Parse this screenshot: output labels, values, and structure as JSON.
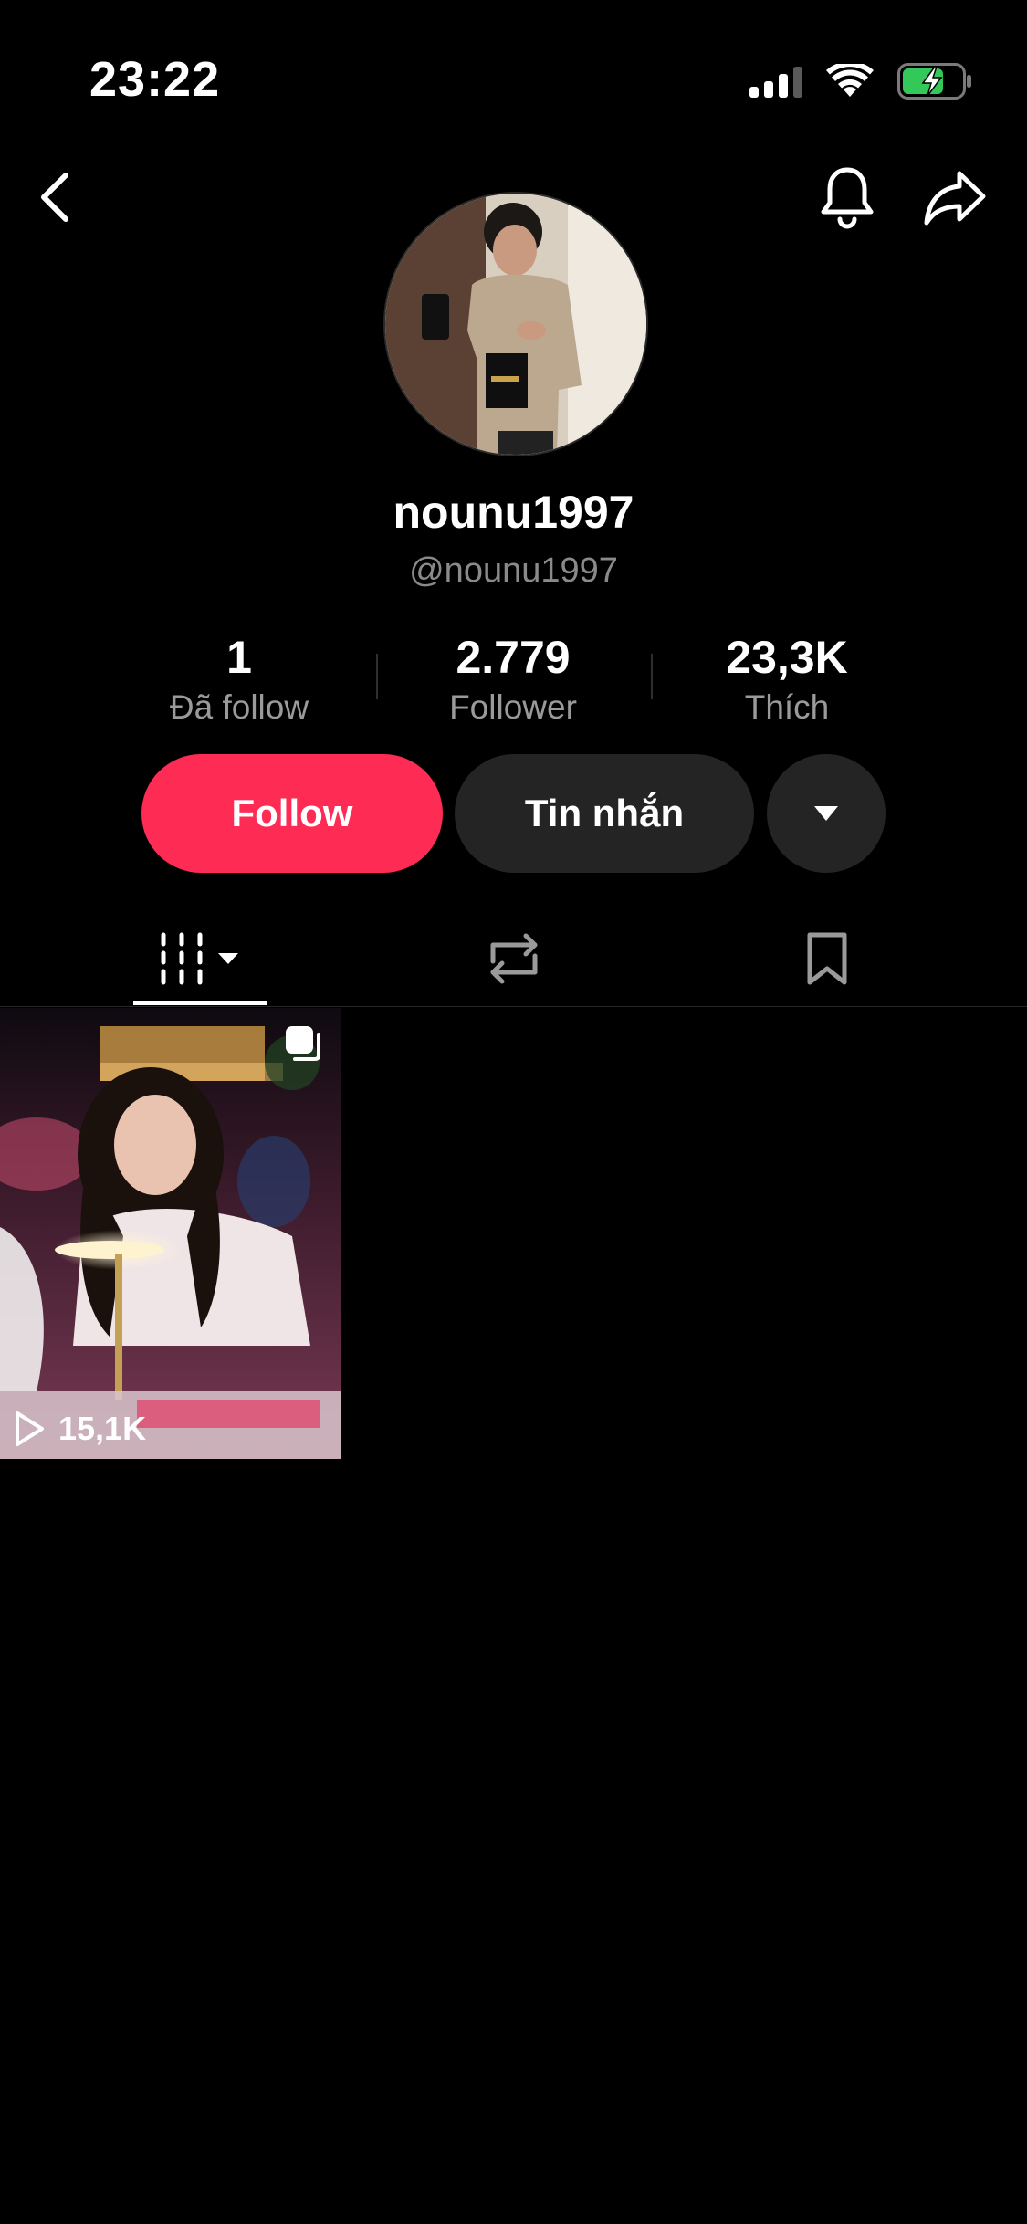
{
  "status_bar": {
    "time": "23:22",
    "icons": [
      "cellular-signal-icon",
      "wifi-icon",
      "battery-charging-icon"
    ]
  },
  "nav": {
    "icons": [
      "chevron-left-icon",
      "bell-icon",
      "share-arrow-icon"
    ]
  },
  "profile": {
    "display_name": "nounu1997",
    "handle": "@nounu1997"
  },
  "stats": [
    {
      "value": "1",
      "label": "Đã follow"
    },
    {
      "value": "2.779",
      "label": "Follower"
    },
    {
      "value": "23,3K",
      "label": "Thích"
    }
  ],
  "actions": {
    "follow_label": "Follow",
    "message_label": "Tin nhắn",
    "more_icon": "caret-down-icon"
  },
  "tabs": {
    "icons": [
      "grid-videos-icon",
      "repost-icon",
      "bookmark-icon"
    ],
    "active": "videos"
  },
  "videos": [
    {
      "views": "15,1K",
      "is_multi": true
    }
  ],
  "colors": {
    "background": "#000000",
    "accent": "#fe2c55",
    "secondary_button": "#242424",
    "muted_text": "#8a8a8a"
  }
}
